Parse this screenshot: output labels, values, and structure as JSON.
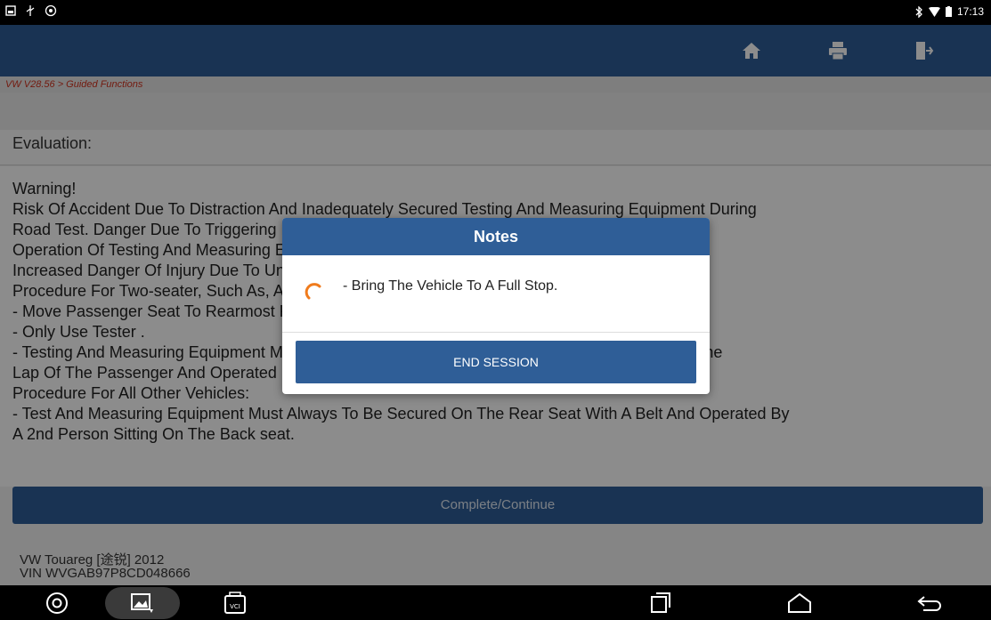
{
  "status_bar": {
    "time": "17:13"
  },
  "breadcrumb": "VW V28.56 > Guided Functions",
  "evaluation_label": "Evaluation:",
  "content_lines": [
    "Warning!",
    " Risk Of Accident Due To Distraction And Inadequately Secured Testing And Measuring Equipment During",
    "Road Test. Danger Due To Triggering Passenger Air Bag In The Event Of A Crash.",
    " Operation Of Testing And Measuring Equipment While Driving Can Lead To Distraction.",
    " Increased Danger Of Injury Due To Unsecured Measuring Equipment.",
    " Procedure For Two-seater, Such As, Audi TT Roadster:",
    " - Move Passenger Seat To Rearmost Position.",
    "- Only Use Tester .",
    "- Testing And Measuring Equipment Must Be Secured As Described In Test Instructions, Flat On The",
    "Lap Of The Passenger And Operated By The Passenger.",
    " Procedure For All Other Vehicles:",
    " - Test And Measuring Equipment Must Always To Be Secured On The Rear Seat With A Belt And Operated By",
    "A 2nd Person Sitting On The Back seat."
  ],
  "continue_label": "Complete/Continue",
  "vehicle": {
    "model": "VW Touareg [途锐] 2012",
    "vin": "VIN WVGAB97P8CD048666"
  },
  "dialog": {
    "title": "Notes",
    "message": "- Bring The Vehicle To A Full Stop.",
    "button": "END SESSION"
  },
  "colors": {
    "primary": "#2f5e97",
    "breadcrumb": "#d2321e",
    "spinner": "#f07b1c"
  },
  "icons": [
    "home-icon",
    "print-icon",
    "exit-icon",
    "chrome-icon",
    "gallery-icon",
    "vci-icon",
    "recent-apps-icon",
    "home-nav-icon",
    "back-icon"
  ]
}
